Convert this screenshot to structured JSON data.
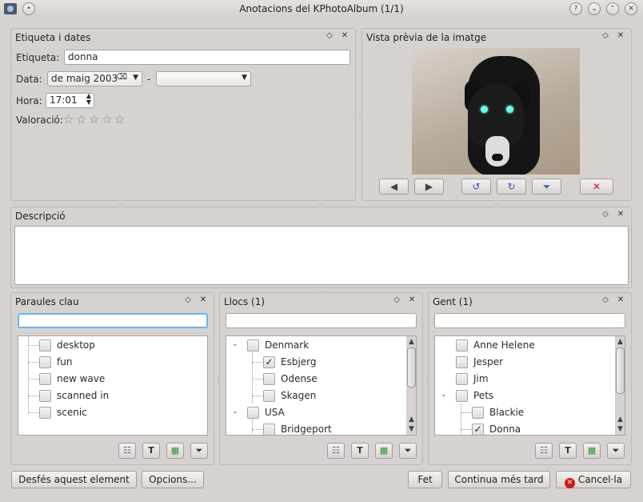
{
  "window": {
    "title": "Anotacions del KPhotoAlbum (1/1)",
    "controls": [
      "?",
      "⌄",
      "⌃",
      "✕"
    ]
  },
  "label_dates": {
    "title": "Etiqueta i dates",
    "label_caption": "Etiqueta:",
    "label_value": "donna",
    "date_caption": "Data:",
    "date_value": "de maig 2003",
    "date_separator": "-",
    "date_end_value": "",
    "time_caption": "Hora:",
    "time_value": "17:01",
    "rating_caption": "Valoració:",
    "rating_value": 0,
    "rating_max": 5
  },
  "preview": {
    "title": "Vista prèvia de la imatge"
  },
  "description": {
    "title": "Descripció",
    "value": ""
  },
  "keywords": {
    "title": "Paraules clau",
    "search": "",
    "items": [
      {
        "label": "desktop",
        "checked": false
      },
      {
        "label": "fun",
        "checked": false
      },
      {
        "label": "new wave",
        "checked": false
      },
      {
        "label": "scanned in",
        "checked": false
      },
      {
        "label": "scenic",
        "checked": false
      }
    ]
  },
  "places": {
    "title": "Llocs (1)",
    "search": "",
    "items": [
      {
        "label": "Denmark",
        "checked": false
      },
      {
        "label": "Esbjerg",
        "checked": true
      },
      {
        "label": "Odense",
        "checked": false
      },
      {
        "label": "Skagen",
        "checked": false
      },
      {
        "label": "USA",
        "checked": false
      },
      {
        "label": "Bridgeport",
        "checked": false
      }
    ]
  },
  "people": {
    "title": "Gent (1)",
    "search": "",
    "items": [
      {
        "label": "Anne Helene",
        "checked": false
      },
      {
        "label": "Jesper",
        "checked": false
      },
      {
        "label": "Jim",
        "checked": false
      },
      {
        "label": "Pets",
        "checked": false
      },
      {
        "label": "Blackie",
        "checked": false
      },
      {
        "label": "Donna",
        "checked": true
      }
    ]
  },
  "footer": {
    "undo": "Desfés aquest element",
    "options": "Opcions...",
    "done": "Fet",
    "continue": "Continua més tard",
    "cancel": "Cancel·la"
  },
  "colors": {
    "background": "#d6d2d0",
    "cancel_icon": "#d01818",
    "focus_border": "#6bb4e8"
  }
}
